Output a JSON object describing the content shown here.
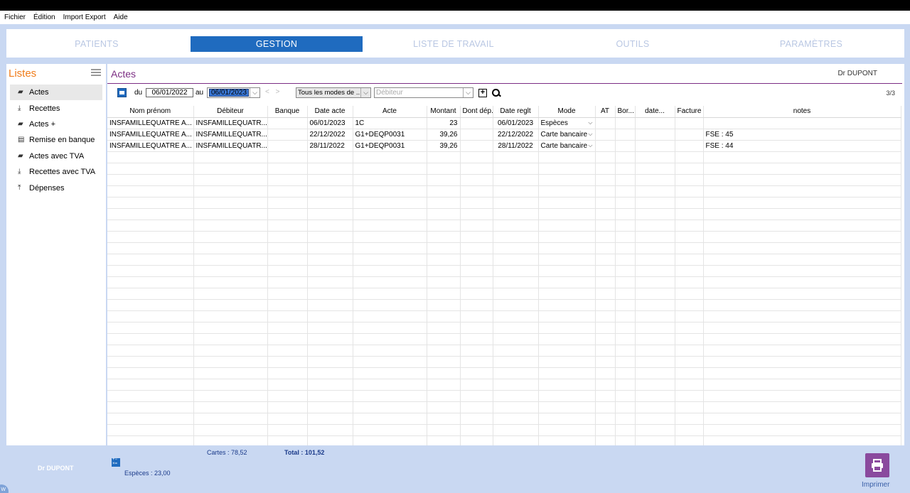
{
  "menu": [
    "Fichier",
    "Édition",
    "Import Export",
    "Aide"
  ],
  "nav": {
    "tabs": [
      "PATIENTS",
      "GESTION",
      "LISTE DE TRAVAIL",
      "OUTILS",
      "PARAMÈTRES"
    ],
    "active": "GESTION"
  },
  "sidebar": {
    "title": "Listes",
    "items": [
      {
        "label": "Actes",
        "icon": "briefcase-icon",
        "active": true
      },
      {
        "label": "Recettes",
        "icon": "download-icon"
      },
      {
        "label": "Actes +",
        "icon": "briefcase-plus-icon"
      },
      {
        "label": "Remise en banque",
        "icon": "document-icon"
      },
      {
        "label": "Actes avec TVA",
        "icon": "briefcase-icon"
      },
      {
        "label": "Recettes avec TVA",
        "icon": "download-icon"
      },
      {
        "label": "Dépenses",
        "icon": "upload-icon"
      }
    ]
  },
  "main": {
    "title": "Actes",
    "doctor": "Dr DUPONT",
    "filters": {
      "du_label": "du",
      "from_date": "06/01/2022",
      "au_label": "au",
      "to_date": "06/01/2023",
      "nav_arrows": "< >",
      "mode_value": "Tous les modes de ...",
      "debiteur_placeholder": "Débiteur"
    },
    "count": "3/3",
    "columns": [
      "Nom prénom",
      "Débiteur",
      "Banque",
      "Date acte",
      "Acte",
      "Montant",
      "Dont dép.",
      "Date reglt",
      "Mode",
      "AT",
      "Bor...",
      "date...",
      "Facture",
      "notes"
    ],
    "rows": [
      [
        "INSFAMILLEQUATRE A...",
        "INSFAMILLEQUATR...",
        "",
        "06/01/2023",
        "1C",
        "23",
        "",
        "06/01/2023",
        "Espèces",
        "",
        "",
        "",
        "",
        ""
      ],
      [
        "INSFAMILLEQUATRE A...",
        "INSFAMILLEQUATR...",
        "",
        "22/12/2022",
        "G1+DEQP0031",
        "39,26",
        "",
        "22/12/2022",
        "Carte bancaire",
        "",
        "",
        "",
        "",
        "FSE : 45"
      ],
      [
        "INSFAMILLEQUATRE A...",
        "INSFAMILLEQUATR...",
        "",
        "28/11/2022",
        "G1+DEQP0031",
        "39,26",
        "",
        "28/11/2022",
        "Carte bancaire",
        "",
        "",
        "",
        "",
        "FSE : 44"
      ]
    ]
  },
  "footer": {
    "doctor": "Dr DUPONT",
    "cartes": "Cartes : 78,52",
    "total": "Total : 101,52",
    "especes": "Espèces : 23,00",
    "print_label": "Imprimer",
    "badge": "W"
  },
  "colors": {
    "accent_blue": "#1f6bbf",
    "title_purple": "#7b2d83",
    "listes_orange": "#f07c1a",
    "print_purple": "#8a4a9e"
  }
}
